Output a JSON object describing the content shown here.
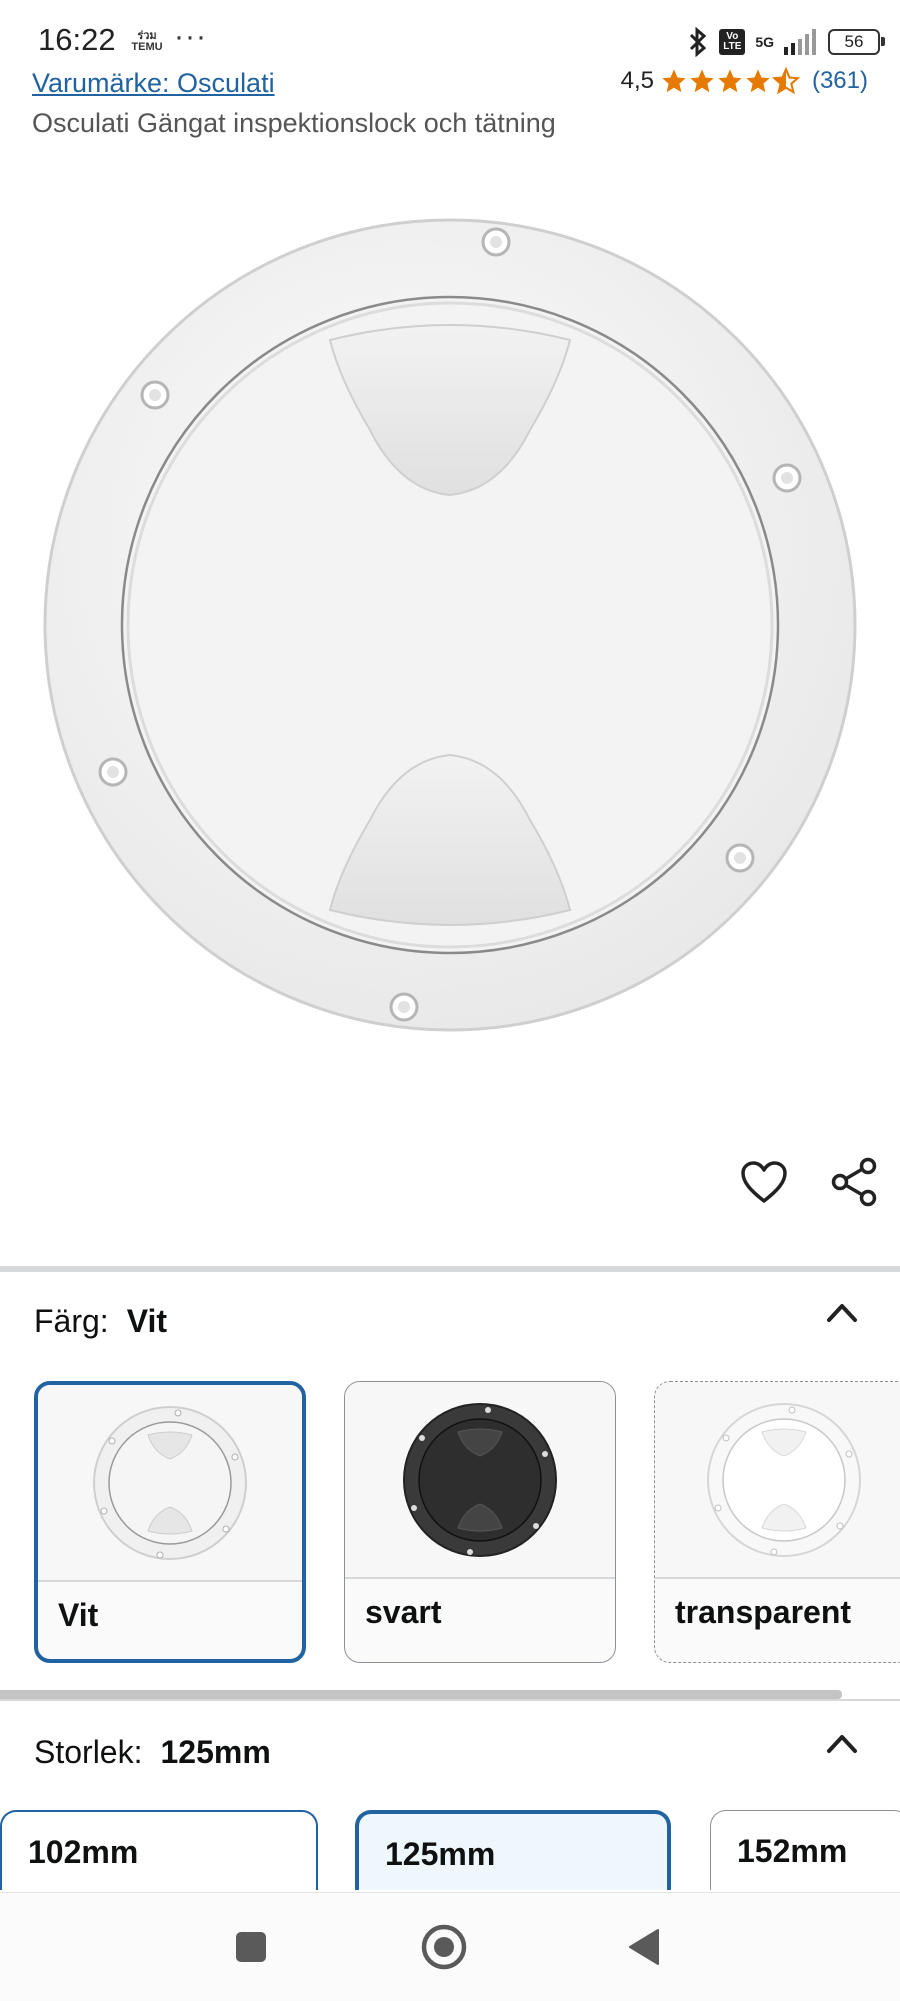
{
  "status_bar": {
    "time": "16:22",
    "temu_label": "ร่วมTEMU",
    "dots": "···",
    "network": "5G",
    "volte": "Vo LTE",
    "battery": "56"
  },
  "header": {
    "brand_link": "Varumärke: Osculati",
    "rating_value": "4,5",
    "rating_stars": 4.5,
    "review_count": "(361)",
    "product_title": "Osculati Gängat inspektionslock och tätning"
  },
  "actions": {
    "wishlist_icon": "heart-icon",
    "share_icon": "share-icon"
  },
  "color_section": {
    "label": "Färg:",
    "selected": "Vit",
    "options": [
      {
        "label": "Vit",
        "color": "#ececec"
      },
      {
        "label": "svart",
        "color": "#2c2c2c"
      },
      {
        "label": "transparent",
        "color": "#f4f4f4"
      }
    ]
  },
  "size_section": {
    "label": "Storlek:",
    "selected": "125mm",
    "options": [
      {
        "label": "102mm"
      },
      {
        "label": "125mm"
      },
      {
        "label": "152mm"
      }
    ]
  },
  "colors": {
    "link": "#2162a1",
    "star": "#e67a00",
    "selected_border": "#2162a1"
  }
}
